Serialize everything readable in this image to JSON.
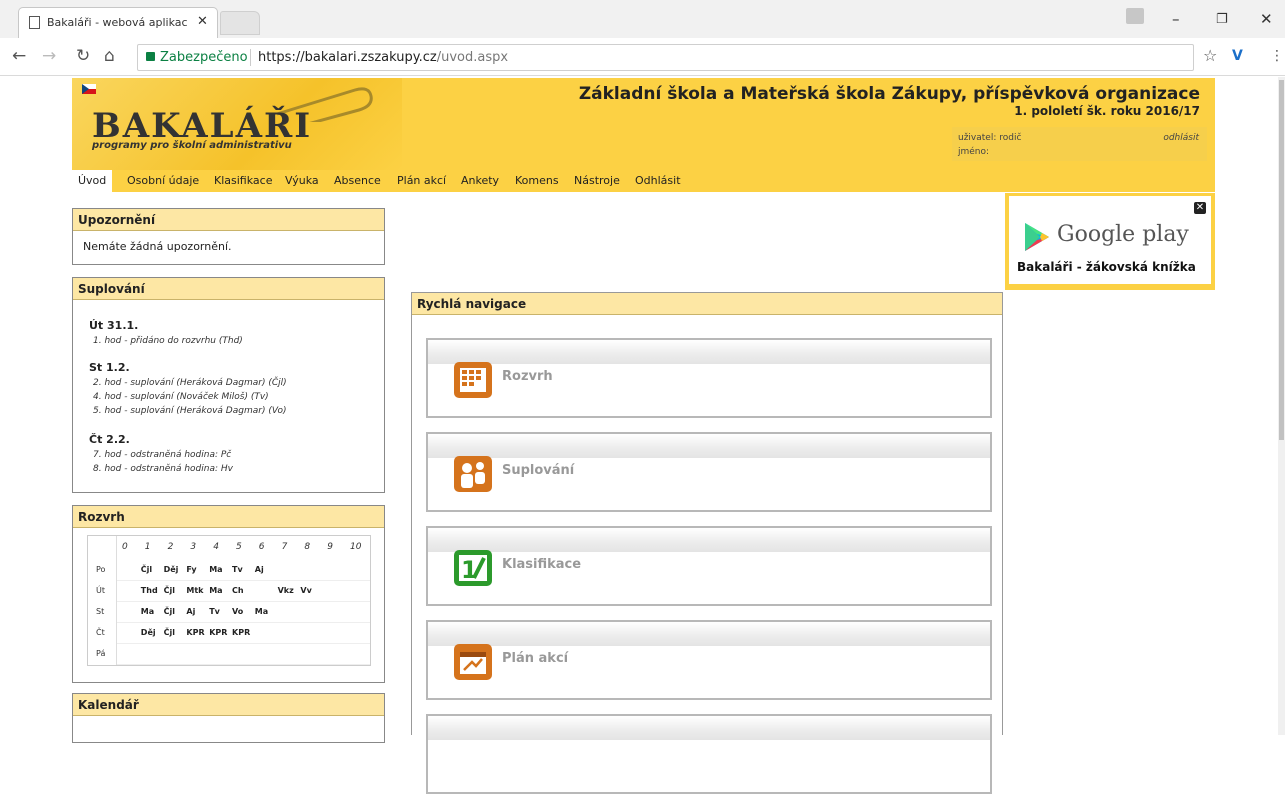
{
  "browser": {
    "tab_title": "Bakaláři - webová aplikac",
    "secure_label": "Zabezpečeno",
    "url_host": "https://bakalari.zszakupy.cz",
    "url_path": "/uvod.aspx"
  },
  "header": {
    "brand": "BAKALÁŘI",
    "tagline": "programy pro školní administrativu",
    "school_name": "Základní škola a Mateřská škola Zákupy, příspěvková organizace",
    "term": "1. pololetí šk. roku 2016/17",
    "user_label": "uživatel: rodič",
    "name_label": "jméno:",
    "logout_link": "odhlásit"
  },
  "menu": [
    "Úvod",
    "Osobní údaje",
    "Klasifikace",
    "Výuka",
    "Absence",
    "Plán akcí",
    "Ankety",
    "Komens",
    "Nástroje",
    "Odhlásit"
  ],
  "notices": {
    "title": "Upozornění",
    "text": "Nemáte žádná upozornění."
  },
  "substitutions": {
    "title": "Suplování",
    "days": [
      {
        "day": "Út 31.1.",
        "items": [
          "1. hod - přidáno do rozvrhu (Thd)"
        ]
      },
      {
        "day": "St 1.2.",
        "items": [
          "2. hod - suplování (Heráková Dagmar) (Čjl)",
          "4. hod - suplování (Nováček Miloš) (Tv)",
          "5. hod - suplování (Heráková Dagmar) (Vo)"
        ]
      },
      {
        "day": "Čt 2.2.",
        "items": [
          "7. hod - odstraněná hodina: Pč",
          "8. hod - odstraněná hodina: Hv"
        ]
      }
    ]
  },
  "timetable": {
    "title": "Rozvrh",
    "hours": [
      "0",
      "1",
      "2",
      "3",
      "4",
      "5",
      "6",
      "7",
      "8",
      "9",
      "10"
    ],
    "days": [
      "Po",
      "Út",
      "St",
      "Čt",
      "Pá"
    ],
    "rows": [
      [
        "",
        "Čjl",
        "Děj",
        "Fy",
        "Ma",
        "Tv",
        "Aj",
        "",
        "",
        "",
        ""
      ],
      [
        "",
        "Thd",
        "Čjl",
        "Mtk",
        "Ma",
        "Ch",
        "",
        "Vkz",
        "Vv",
        "",
        ""
      ],
      [
        "",
        "Ma",
        "Čjl",
        "Aj",
        "Tv",
        "Vo",
        "Ma",
        "",
        "",
        "",
        ""
      ],
      [
        "",
        "Děj",
        "Čjl",
        "KPR",
        "KPR",
        "KPR",
        "",
        "",
        "",
        "",
        ""
      ],
      [
        "",
        "",
        "",
        "",
        "",
        "",
        "",
        "",
        "",
        "",
        ""
      ]
    ]
  },
  "calendar": {
    "title": "Kalendář"
  },
  "ad": {
    "store": "Google play",
    "caption": "Bakaláři - žákovská knížka"
  },
  "quicknav": {
    "title": "Rychlá navigace",
    "items": [
      {
        "label": "Rozvrh",
        "icon": "timetable-icon",
        "color": "#d5731c"
      },
      {
        "label": "Suplování",
        "icon": "substitution-icon",
        "color": "#d5731c"
      },
      {
        "label": "Klasifikace",
        "icon": "grades-icon",
        "color": "#2c9a2c"
      },
      {
        "label": "Plán akcí",
        "icon": "events-icon",
        "color": "#d5731c"
      }
    ]
  }
}
